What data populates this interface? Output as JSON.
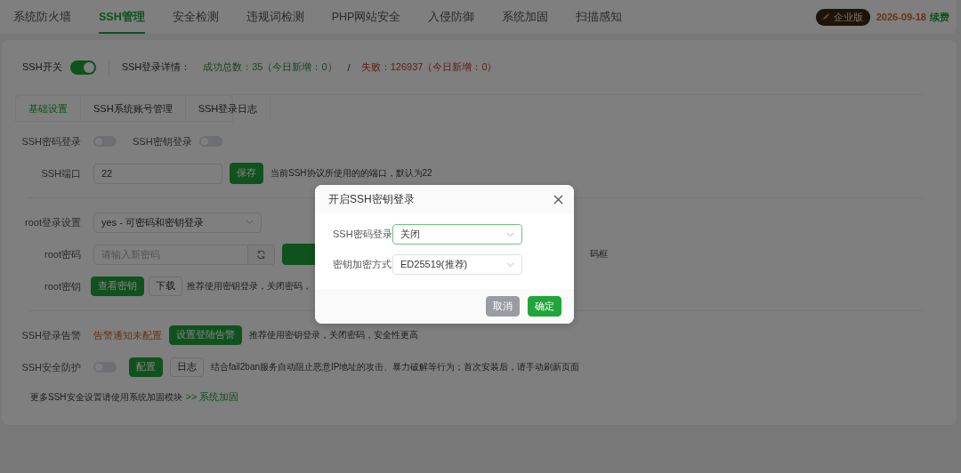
{
  "nav": {
    "tabs": [
      {
        "label": "系统防火墙",
        "selected": false
      },
      {
        "label": "SSH管理",
        "selected": true
      },
      {
        "label": "安全检测",
        "selected": false
      },
      {
        "label": "违规词检测",
        "selected": false
      },
      {
        "label": "PHP网站安全",
        "selected": false
      },
      {
        "label": "入侵防御",
        "selected": false
      },
      {
        "label": "系统加固",
        "selected": false
      },
      {
        "label": "扫描感知",
        "selected": false
      }
    ],
    "edition_badge": "企业版",
    "expiry": "2026-09-18",
    "renew_link": "续费"
  },
  "status": {
    "switch_label": "SSH开关",
    "switch_on": true,
    "details_label": "SSH登录详情：",
    "success": "成功总数：35（今日新增：0）",
    "separator": "/",
    "failure": "失败：126937（今日新增：0）"
  },
  "subtabs": [
    {
      "label": "基础设置",
      "selected": true
    },
    {
      "label": "SSH系统账号管理",
      "selected": false
    },
    {
      "label": "SSH登录日志",
      "selected": false
    }
  ],
  "settings": {
    "password_login": {
      "label": "SSH密码登录",
      "on": false
    },
    "key_login": {
      "label": "SSH密钥登录",
      "on": false
    },
    "port": {
      "label": "SSH端口",
      "value": "22",
      "button": "保存",
      "hint": "当前SSH协议所使用的的端口，默认为22"
    },
    "root_login": {
      "label": "root登录设置",
      "value": "yes - 可密码和密钥登录"
    },
    "root_password": {
      "label": "root密码",
      "placeholder": "请输入新密码",
      "hint": "码框"
    },
    "root_key": {
      "label": "root密钥",
      "view_button": "查看密钥",
      "download_button": "下载",
      "hint": "推荐使用密钥登录，关闭密码，"
    },
    "alert": {
      "label": "SSH登录告警",
      "status": "告警通知未配置",
      "button": "设置登陆告警",
      "hint": "推荐使用密钥登录，关闭密码，安全性更高"
    },
    "protection": {
      "label": "SSH安全防护",
      "on": false,
      "config_button": "配置",
      "log_button": "日志",
      "hint": "结合fail2ban服务自动阻止恶意IP地址的攻击、暴力破解等行为；首次安装后，请手动刷新页面"
    },
    "footer": {
      "text": "更多SSH安全设置请使用系统加固模块",
      "link": ">> 系统加固"
    }
  },
  "dialog": {
    "title": "开启SSH密钥登录",
    "fields": [
      {
        "label": "SSH密码登录",
        "value": "关闭",
        "focused": true
      },
      {
        "label": "密钥加密方式",
        "value": "ED25519(推荐)",
        "focused": false
      }
    ],
    "cancel": "取消",
    "confirm": "确定"
  }
}
